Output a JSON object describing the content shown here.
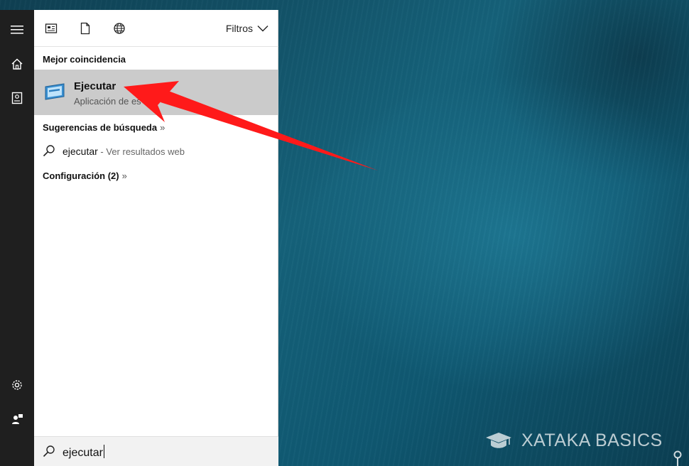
{
  "topbar": {
    "filters_label": "Filtros",
    "icons": [
      "apps-icon",
      "document-icon",
      "web-globe-icon",
      "chevron-down-icon"
    ]
  },
  "rail": {
    "icons": [
      "hamburger-menu-icon",
      "home-icon",
      "notebook-icon",
      "settings-gear-icon",
      "feedback-icon"
    ]
  },
  "best_match": {
    "heading": "Mejor coincidencia",
    "title": "Ejecutar",
    "subtitle": "Aplicación de es"
  },
  "suggestions": {
    "heading": "Sugerencias de búsqueda",
    "chevrons": "»",
    "item_query": "ejecutar",
    "item_suffix": " - Ver resultados web"
  },
  "settings": {
    "heading": "Configuración (2)",
    "chevrons": "»"
  },
  "searchbox": {
    "value": "ejecutar"
  },
  "watermark": {
    "text": "XATAKA BASICS"
  },
  "colors": {
    "rail_bg": "#1f1f1f",
    "selected_bg": "#cbcbcb",
    "arrow_red": "#ff1a1a",
    "desktop_teal": "#15627a"
  }
}
